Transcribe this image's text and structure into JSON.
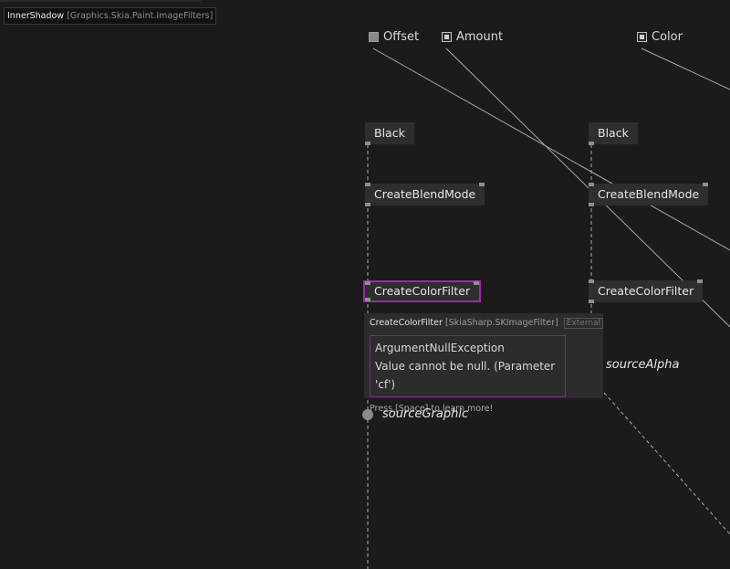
{
  "patch": {
    "name": "InnerShadow",
    "namespace": "[Graphics.Skia.Paint.ImageFilters]"
  },
  "inputs": [
    {
      "label": "Offset",
      "icon": "square-pin-icon"
    },
    {
      "label": "Amount",
      "icon": "radio-pin-icon"
    },
    {
      "label": "Color",
      "icon": "radio-pin-icon"
    }
  ],
  "nodes": {
    "black_left": "Black",
    "blend_left": "CreateBlendMode",
    "colorfilter_left": "CreateColorFilter",
    "black_right": "Black",
    "blend_right": "CreateBlendMode",
    "colorfilter_right": "CreateColorFilter"
  },
  "tooltip": {
    "node_name": "CreateColorFilter",
    "type_name": "[SkiaSharp.SKImageFilter]",
    "badge": "External",
    "error_title": "ArgumentNullException",
    "error_message": "Value cannot be null. (Parameter 'cf')",
    "hint": "Press [Space] to learn more!"
  },
  "io": {
    "source_alpha": "sourceAlpha",
    "source_graphic": "sourceGraphic"
  },
  "colors": {
    "background": "#1b1b1b",
    "node": "#2e2e2e",
    "selection": "#9b2aa8",
    "error_border": "#7b2a86",
    "wire": "#a8a8a8"
  }
}
